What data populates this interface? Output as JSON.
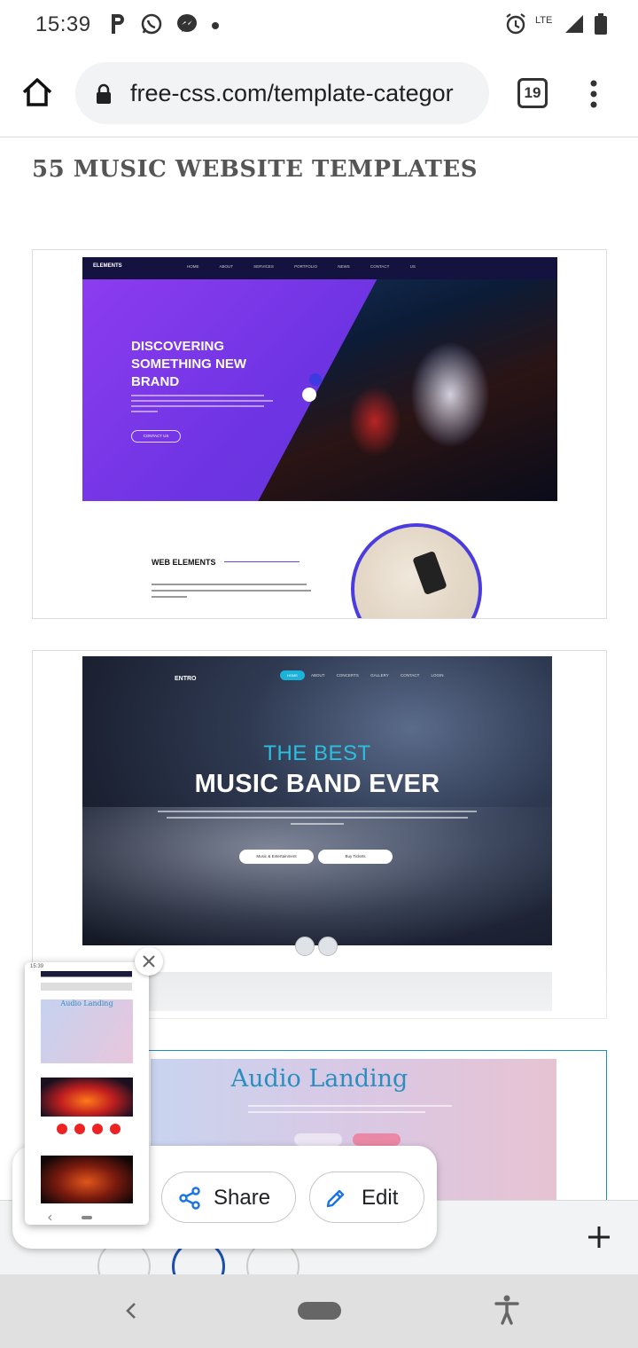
{
  "status_bar": {
    "time": "15:39",
    "left_icons": [
      "parking-icon",
      "whatsapp-icon",
      "messenger-icon",
      "dot-icon"
    ],
    "right_icons": [
      "alarm-icon",
      "lte-icon",
      "signal-icon",
      "battery-icon"
    ],
    "network": "LTE"
  },
  "browser": {
    "url": "free-css.com/template-categor",
    "tab_count": "19"
  },
  "page": {
    "heading": "55 MUSIC WEBSITE TEMPLATES",
    "templates": [
      {
        "nav_logo": "ELEMENTS",
        "nav_links": "HOME ABOUT SERVICES PORTFOLIO NEWS CONTACT US",
        "hero_heading": "DISCOVERING SOMETHING NEW BRAND",
        "hero_button": "CONTACT US",
        "section_label": "WEB ELEMENTS"
      },
      {
        "nav_logo": "ENTRO",
        "nav_home": "HOME",
        "nav_links": "ABOUT CONCERTS GALLERY CONTACT LOGIN",
        "hero_small": "THE BEST",
        "hero_big": "MUSIC BAND EVER",
        "button_a": "Music & Entertainment",
        "button_b": "Buy Tickets"
      },
      {
        "title": "Audio Landing"
      }
    ]
  },
  "screenshot_overlay": {
    "share_label": "Share",
    "edit_label": "Edit",
    "thumb_label": "Audio Landing"
  },
  "colors": {
    "accent_blue": "#1a73e8",
    "title_gray": "#555555",
    "audio_landing_title": "#2a8ec0"
  }
}
